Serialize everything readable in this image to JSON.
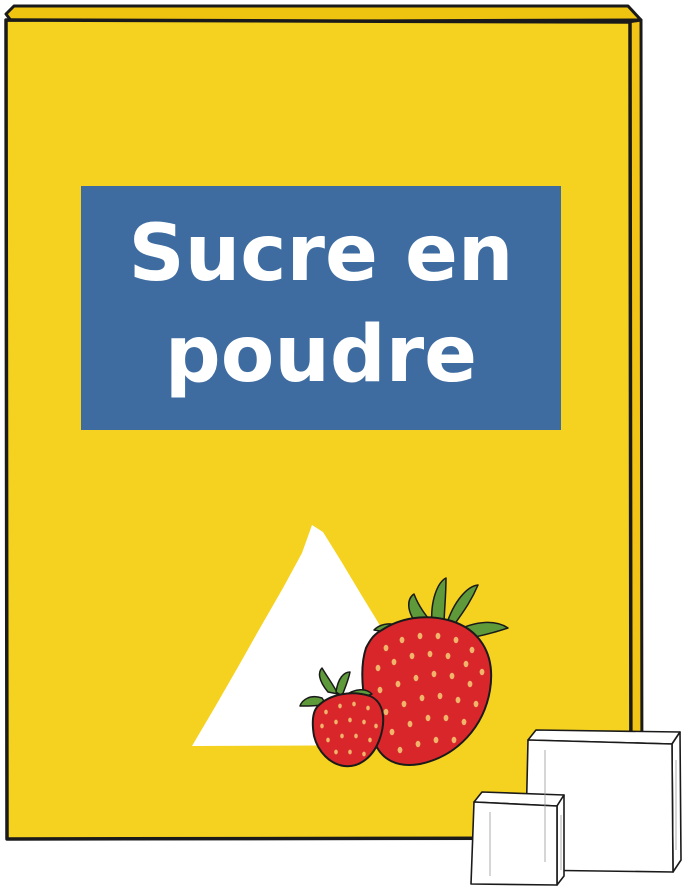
{
  "package": {
    "label_line1": "Sucre en",
    "label_line2": "poudre"
  },
  "colors": {
    "box_front": "#F5D21F",
    "box_side": "#F2C416",
    "box_top": "#EEC410",
    "label_bg": "#3E6CA1",
    "label_text": "#FFFFFF",
    "strawberry": "#D8262A",
    "seed": "#F2B46B",
    "leaf": "#5E9A3A",
    "sugar_pile": "#FFFFFF",
    "outline": "#1A1A1A"
  },
  "icons": {
    "sugar_pile": "triangle-pile-icon",
    "strawberries": "strawberry-icon",
    "sugar_cubes": "sugar-cube-icon"
  }
}
